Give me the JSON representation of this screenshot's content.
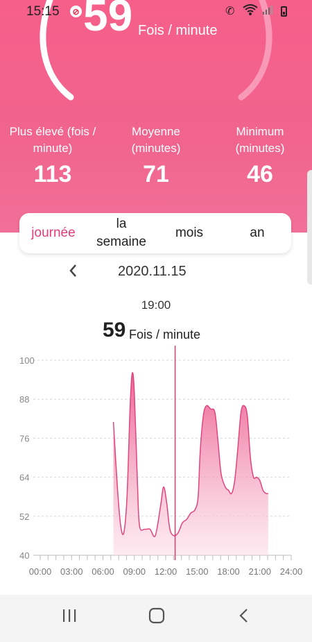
{
  "status_bar": {
    "time": "15:15",
    "alarm_glyph": "⊘"
  },
  "current": {
    "value": "59",
    "unit": "Fois / minute"
  },
  "stats": [
    {
      "label_line1": "Plus élevé (fois /",
      "label_line2": "minute)",
      "value": "113"
    },
    {
      "label_line1": "Moyenne",
      "label_line2": "(minutes)",
      "value": "71"
    },
    {
      "label_line1": "Minimum",
      "label_line2": "(minutes)",
      "value": "46"
    }
  ],
  "tabs": [
    {
      "label": "journée",
      "active": true
    },
    {
      "label_line1": "la",
      "label_line2": "semaine",
      "active": false
    },
    {
      "label": "mois",
      "active": false
    },
    {
      "label": "an",
      "active": false
    }
  ],
  "date": "2020.11.15",
  "selection": {
    "time": "19:00",
    "value": "59",
    "unit": "Fois / minute"
  },
  "colors": {
    "accent": "#f0648d",
    "chart_line": "#e0457d",
    "cursor": "#c8426d"
  },
  "chart_data": {
    "type": "area",
    "ylim": [
      40,
      100
    ],
    "yticks": [
      40,
      52,
      64,
      76,
      88,
      100
    ],
    "xticks": [
      "00:00",
      "03:00",
      "06:00",
      "09:00",
      "12:00",
      "15:00",
      "18:00",
      "21:00",
      "24:00"
    ],
    "xlim": [
      0,
      24
    ],
    "grid": true,
    "cursor_hour": 12.9,
    "points": [
      [
        7.0,
        81
      ],
      [
        7.4,
        60
      ],
      [
        7.7,
        49
      ],
      [
        8.0,
        47
      ],
      [
        8.3,
        58
      ],
      [
        8.6,
        86
      ],
      [
        8.8,
        96
      ],
      [
        9.0,
        90
      ],
      [
        9.3,
        62
      ],
      [
        9.5,
        49
      ],
      [
        10.0,
        48
      ],
      [
        10.5,
        48
      ],
      [
        11.0,
        46
      ],
      [
        11.5,
        55
      ],
      [
        11.8,
        61
      ],
      [
        12.1,
        56
      ],
      [
        12.4,
        48
      ],
      [
        12.8,
        46
      ],
      [
        13.2,
        47
      ],
      [
        13.6,
        50
      ],
      [
        14.0,
        51
      ],
      [
        14.4,
        53
      ],
      [
        14.8,
        54
      ],
      [
        15.1,
        58
      ],
      [
        15.3,
        72
      ],
      [
        15.6,
        83
      ],
      [
        15.9,
        86
      ],
      [
        16.3,
        85
      ],
      [
        16.7,
        84
      ],
      [
        17.0,
        75
      ],
      [
        17.3,
        65
      ],
      [
        17.7,
        61
      ],
      [
        18.0,
        60
      ],
      [
        18.3,
        59
      ],
      [
        18.6,
        63
      ],
      [
        18.9,
        73
      ],
      [
        19.2,
        84
      ],
      [
        19.5,
        86
      ],
      [
        19.8,
        83
      ],
      [
        20.1,
        70
      ],
      [
        20.4,
        64
      ],
      [
        20.7,
        64
      ],
      [
        21.0,
        63
      ],
      [
        21.3,
        60
      ],
      [
        21.6,
        59
      ],
      [
        21.8,
        59
      ]
    ]
  }
}
